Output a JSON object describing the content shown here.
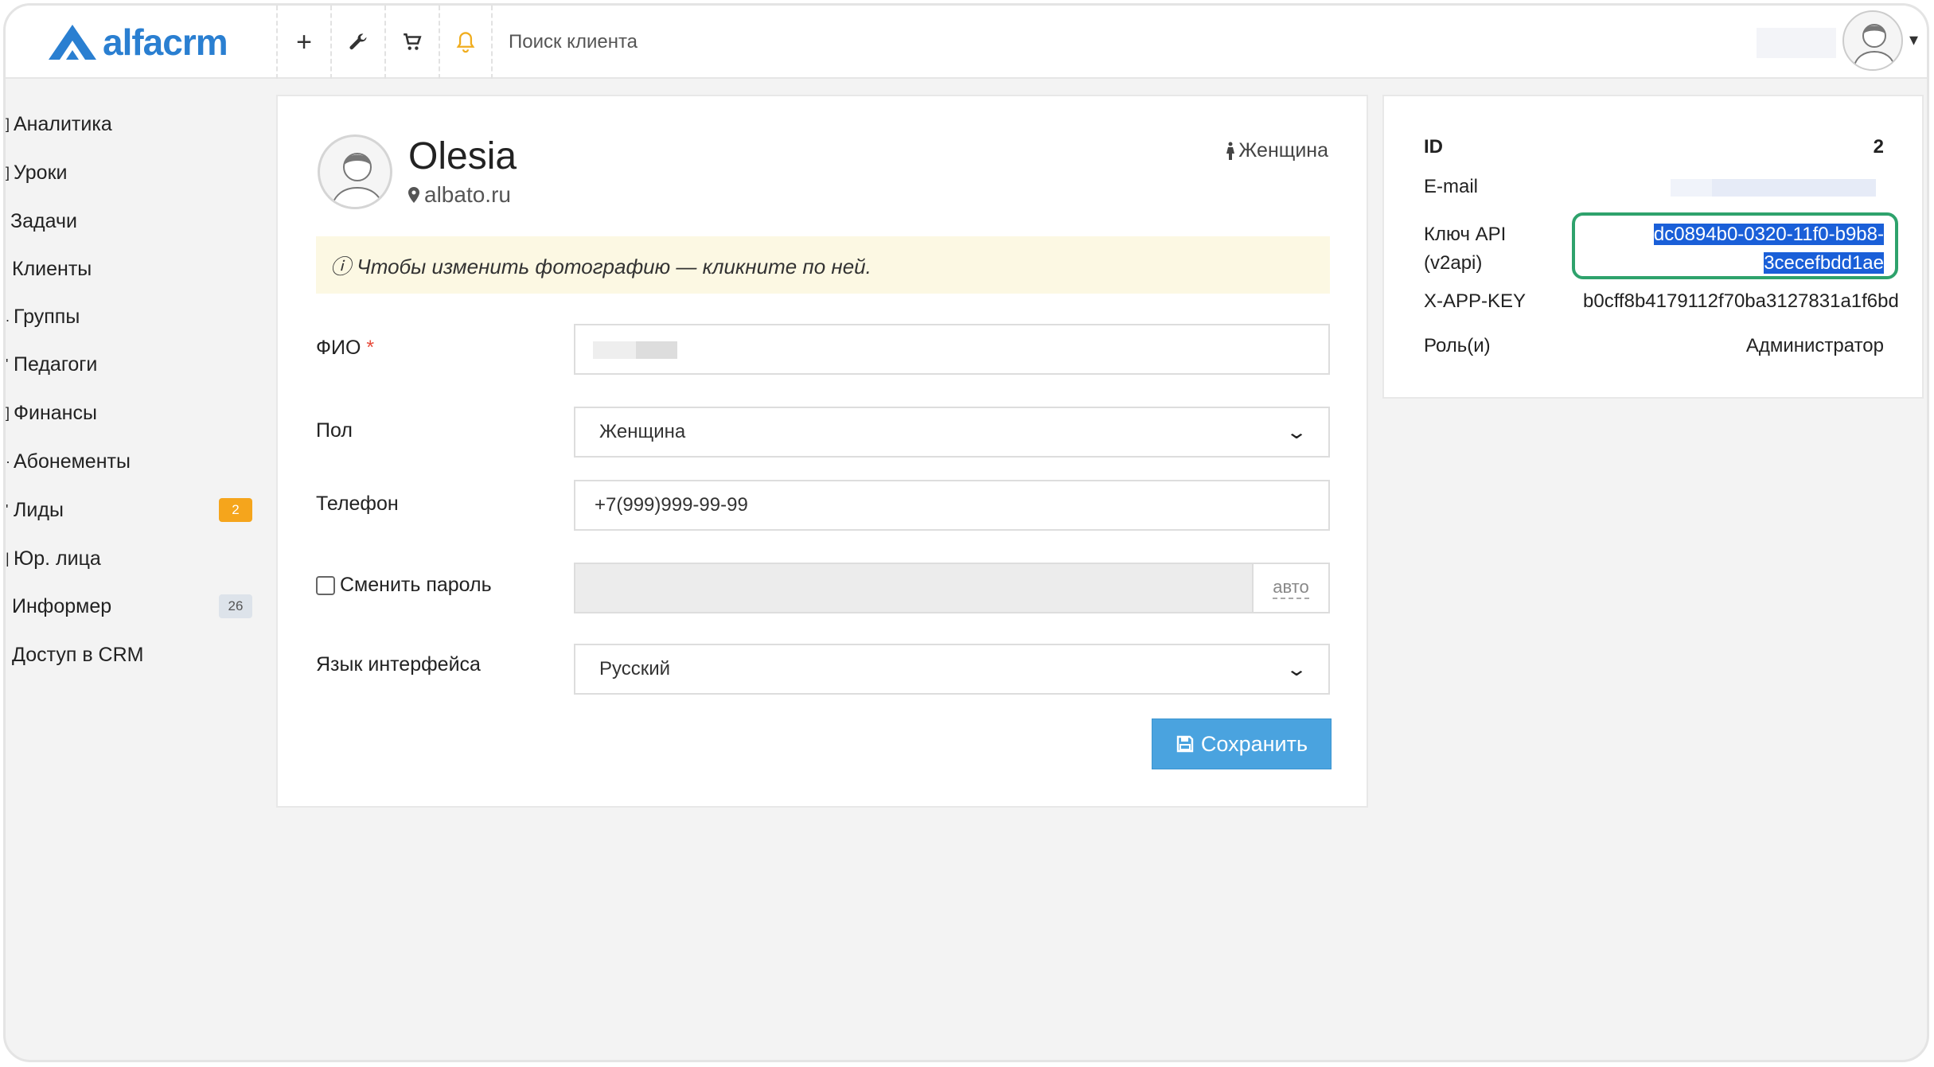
{
  "app": {
    "logo_text": "alfacrm",
    "brand_color": "#2a7fd1",
    "accent_color": "#4aa3df"
  },
  "toolbar": {
    "add_icon": "plus-icon",
    "settings_icon": "wrench-icon",
    "cart_icon": "cart-icon",
    "notifications_icon": "bell-icon",
    "search_placeholder": "Поиск клиента"
  },
  "sidebar": {
    "items": [
      {
        "label": "Аналитика"
      },
      {
        "label": "Уроки"
      },
      {
        "label": "Задачи"
      },
      {
        "label": "Клиенты"
      },
      {
        "label": "Группы"
      },
      {
        "label": "Педагоги"
      },
      {
        "label": "Финансы"
      },
      {
        "label": "Абонементы"
      },
      {
        "label": "Лиды",
        "badge": "2"
      },
      {
        "label": "Юр. лица"
      },
      {
        "label": "Информер",
        "badge": "26"
      },
      {
        "label": "Доступ в CRM"
      }
    ]
  },
  "profile": {
    "name": "Olesia",
    "site": "albato.ru",
    "gender": "Женщина",
    "notice": "ⓘ Чтобы изменить фотографию — кликните по ней.",
    "form": {
      "fio_label": "ФИО",
      "required_mark": "*",
      "gender_label": "Пол",
      "gender_value": "Женщина",
      "phone_label": "Телефон",
      "phone_value": "+7(999)999-99-99",
      "change_password_label": "Сменить пароль",
      "password_addon": "авто",
      "language_label": "Язык интерфейса",
      "language_value": "Русский",
      "save_label": "Сохранить"
    }
  },
  "info": {
    "id_label": "ID",
    "id_value": "2",
    "email_label": "E-mail",
    "api_key_label_1": "Ключ API",
    "api_key_label_2": "(v2api)",
    "api_key_line_1": "dc0894b0-0320-11f0-b9b8-",
    "api_key_line_2": "3cecefbdd1ae",
    "xapp_label": "X-APP-KEY",
    "xapp_value": "b0cff8b4179112f70ba3127831a1f6bd",
    "roles_label": "Роль(и)",
    "roles_value": "Администратор"
  }
}
